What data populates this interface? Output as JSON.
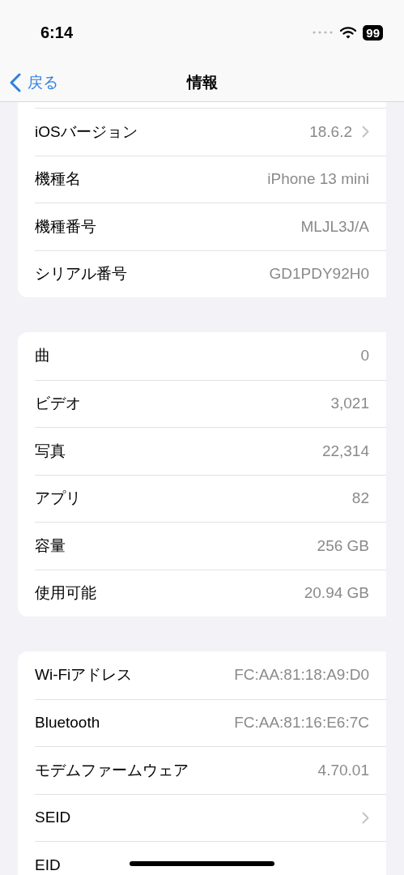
{
  "status_bar": {
    "time": "6:14",
    "battery": "99"
  },
  "nav": {
    "back": "戻る",
    "title": "情報"
  },
  "sections": [
    {
      "rows": [
        {
          "label": "iOSバージョン",
          "value": "18.6.2",
          "chevron": true
        },
        {
          "label": "機種名",
          "value": "iPhone 13 mini",
          "chevron": false
        },
        {
          "label": "機種番号",
          "value": "MLJL3J/A",
          "chevron": false
        },
        {
          "label": "シリアル番号",
          "value": "GD1PDY92H0",
          "chevron": false
        }
      ]
    },
    {
      "rows": [
        {
          "label": "曲",
          "value": "0",
          "chevron": false
        },
        {
          "label": "ビデオ",
          "value": "3,021",
          "chevron": false
        },
        {
          "label": "写真",
          "value": "22,314",
          "chevron": false
        },
        {
          "label": "アプリ",
          "value": "82",
          "chevron": false
        },
        {
          "label": "容量",
          "value": "256 GB",
          "chevron": false
        },
        {
          "label": "使用可能",
          "value": "20.94 GB",
          "chevron": false
        }
      ]
    },
    {
      "rows": [
        {
          "label": "Wi-Fiアドレス",
          "value": "FC:AA:81:18:A9:D0",
          "chevron": false
        },
        {
          "label": "Bluetooth",
          "value": "FC:AA:81:16:E6:7C",
          "chevron": false
        },
        {
          "label": "モデムファームウェア",
          "value": "4.70.01",
          "chevron": false
        },
        {
          "label": "SEID",
          "chevron": true
        },
        {
          "label": "EID",
          "chevron": false
        }
      ]
    }
  ]
}
